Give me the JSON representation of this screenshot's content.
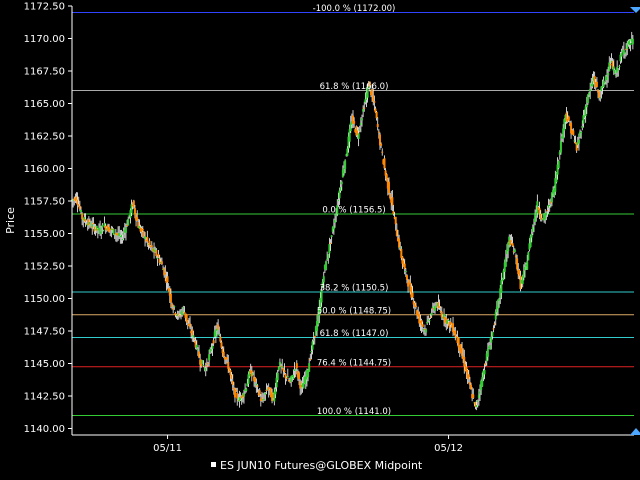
{
  "chart_data": {
    "type": "line",
    "title": "",
    "xlabel": "",
    "ylabel": "Price",
    "ylim": [
      1139.5,
      1172.5
    ],
    "y_ticks": [
      1140.0,
      1142.5,
      1145.0,
      1147.5,
      1150.0,
      1152.5,
      1155.0,
      1157.5,
      1160.0,
      1162.5,
      1165.0,
      1167.5,
      1170.0,
      1172.5
    ],
    "y_tick_labels": [
      "1140.00",
      "1142.50",
      "1145.00",
      "1147.50",
      "1150.00",
      "1152.50",
      "1155.00",
      "1157.50",
      "1160.00",
      "1162.50",
      "1165.00",
      "1167.50",
      "1170.00",
      "1172.50"
    ],
    "x_range": [
      0,
      100
    ],
    "x_ticks": [
      {
        "x": 17,
        "label": "05/11"
      },
      {
        "x": 67,
        "label": "05/12"
      }
    ],
    "grid": false,
    "legend": {
      "position": "bottom-center",
      "entries": [
        "ES JUN10 Futures@GLOBEX Midpoint"
      ]
    },
    "colors": {
      "up": "#33cc33",
      "down": "#ff8800",
      "wick": "#ffffff",
      "axis": "#ffffff",
      "background": "#000000"
    },
    "fib_levels": [
      {
        "label": "-100.0 % (1172.00)",
        "value": 1172.0,
        "color": "#3344ff"
      },
      {
        "label": "61.8 % (1166.0)",
        "value": 1166.0,
        "color": "#aaaaaa"
      },
      {
        "label": "0.0 % (1156.5)",
        "value": 1156.5,
        "color": "#33cc33"
      },
      {
        "label": "38.2 % (1150.5)",
        "value": 1150.5,
        "color": "#33cccc"
      },
      {
        "label": "50.0 % (1148.75)",
        "value": 1148.75,
        "color": "#ddaa66"
      },
      {
        "label": "61.8 % (1147.0)",
        "value": 1147.0,
        "color": "#33cccc"
      },
      {
        "label": "76.4 % (1144.75)",
        "value": 1144.75,
        "color": "#dd2222"
      },
      {
        "label": "100.0 % (1141.0)",
        "value": 1141.0,
        "color": "#33cc33"
      }
    ],
    "series": [
      {
        "values": [
          [
            0,
            1157.5
          ],
          [
            1,
            1157.8
          ],
          [
            2,
            1156.2
          ],
          [
            3,
            1155.8
          ],
          [
            4,
            1155.5
          ],
          [
            5,
            1155.2
          ],
          [
            6,
            1155.6
          ],
          [
            7,
            1155.3
          ],
          [
            8,
            1155.0
          ],
          [
            9,
            1154.6
          ],
          [
            10,
            1155.8
          ],
          [
            11,
            1157.3
          ],
          [
            12,
            1155.6
          ],
          [
            13,
            1154.8
          ],
          [
            14,
            1154.0
          ],
          [
            15,
            1153.5
          ],
          [
            16,
            1152.8
          ],
          [
            17,
            1151.5
          ],
          [
            18,
            1149.5
          ],
          [
            19,
            1148.6
          ],
          [
            20,
            1149.2
          ],
          [
            21,
            1147.8
          ],
          [
            22,
            1146.8
          ],
          [
            23,
            1145.2
          ],
          [
            24,
            1144.6
          ],
          [
            25,
            1146.2
          ],
          [
            26,
            1147.8
          ],
          [
            27,
            1146.0
          ],
          [
            28,
            1144.8
          ],
          [
            29,
            1142.8
          ],
          [
            30,
            1142.2
          ],
          [
            31,
            1143.0
          ],
          [
            32,
            1144.5
          ],
          [
            33,
            1143.2
          ],
          [
            34,
            1142.0
          ],
          [
            35,
            1143.2
          ],
          [
            36,
            1142.2
          ],
          [
            37,
            1145.0
          ],
          [
            38,
            1144.2
          ],
          [
            39,
            1143.5
          ],
          [
            40,
            1144.8
          ],
          [
            41,
            1143.0
          ],
          [
            42,
            1144.2
          ],
          [
            43,
            1146.5
          ],
          [
            44,
            1148.5
          ],
          [
            45,
            1152.0
          ],
          [
            46,
            1154.0
          ],
          [
            47,
            1156.2
          ],
          [
            48,
            1158.8
          ],
          [
            49,
            1161.2
          ],
          [
            50,
            1163.8
          ],
          [
            51,
            1162.5
          ],
          [
            52,
            1164.5
          ],
          [
            53,
            1166.5
          ],
          [
            54,
            1164.8
          ],
          [
            55,
            1162.0
          ],
          [
            56,
            1159.5
          ],
          [
            57,
            1157.5
          ],
          [
            58,
            1155.0
          ],
          [
            59,
            1152.8
          ],
          [
            60,
            1151.2
          ],
          [
            61,
            1149.8
          ],
          [
            62,
            1148.3
          ],
          [
            63,
            1147.6
          ],
          [
            64,
            1148.8
          ],
          [
            65,
            1149.6
          ],
          [
            66,
            1148.8
          ],
          [
            67,
            1148.2
          ],
          [
            68,
            1147.7
          ],
          [
            69,
            1146.5
          ],
          [
            70,
            1145.0
          ],
          [
            71,
            1143.2
          ],
          [
            72,
            1141.5
          ],
          [
            73,
            1143.5
          ],
          [
            74,
            1145.6
          ],
          [
            75,
            1147.4
          ],
          [
            76,
            1149.6
          ],
          [
            77,
            1152.2
          ],
          [
            78,
            1154.6
          ],
          [
            79,
            1153.5
          ],
          [
            80,
            1151.0
          ],
          [
            81,
            1152.5
          ],
          [
            82,
            1155.2
          ],
          [
            83,
            1157.2
          ],
          [
            84,
            1156.0
          ],
          [
            85,
            1157.0
          ],
          [
            86,
            1158.5
          ],
          [
            87,
            1161.5
          ],
          [
            88,
            1164.2
          ],
          [
            89,
            1163.0
          ],
          [
            90,
            1161.5
          ],
          [
            91,
            1163.5
          ],
          [
            92,
            1165.5
          ],
          [
            93,
            1167.0
          ],
          [
            94,
            1165.5
          ],
          [
            95,
            1166.8
          ],
          [
            96,
            1168.2
          ],
          [
            97,
            1167.2
          ],
          [
            98,
            1168.8
          ],
          [
            99,
            1169.5
          ],
          [
            100,
            1169.8
          ]
        ]
      }
    ]
  }
}
